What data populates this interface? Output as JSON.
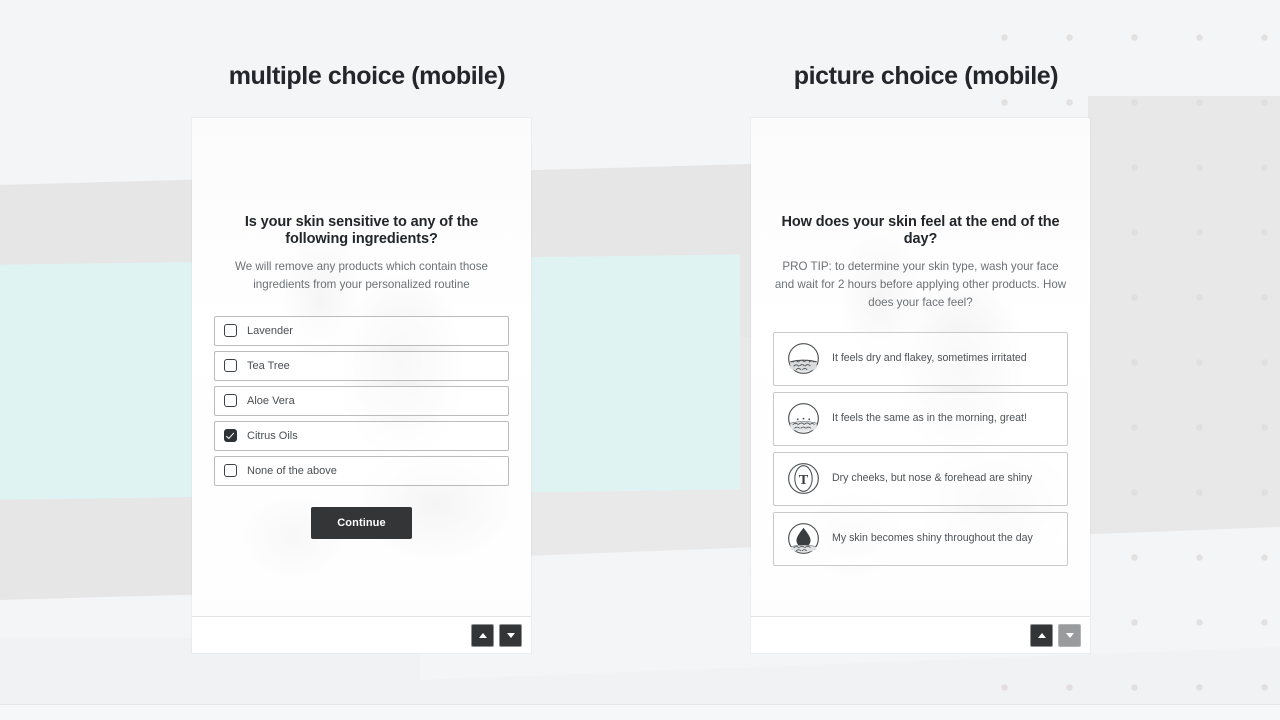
{
  "panels": [
    {
      "title": "multiple choice (mobile)",
      "type": "checkbox",
      "question": "Is your skin sensitive to any of the following ingredients?",
      "subtitle": "We will remove any products which contain those ingredients from your personalized routine",
      "options": [
        {
          "label": "Lavender",
          "checked": false
        },
        {
          "label": "Tea Tree",
          "checked": false
        },
        {
          "label": "Aloe Vera",
          "checked": false
        },
        {
          "label": "Citrus Oils",
          "checked": true
        },
        {
          "label": "None of the above",
          "checked": false
        }
      ],
      "continue_label": "Continue",
      "nav": {
        "up_icon": "triangle-up-icon",
        "down_icon": "triangle-down-icon",
        "up_disabled": false,
        "down_disabled": false
      }
    },
    {
      "title": "picture choice (mobile)",
      "type": "picture",
      "question": "How does your skin feel at the end of the day?",
      "subtitle": "PRO TIP: to determine your skin type, wash your face and wait for 2 hours before applying other products. How does your face feel?",
      "options": [
        {
          "label": "It feels dry and flakey, sometimes irritated",
          "icon": "dry-skin-icon"
        },
        {
          "label": "It feels the same as in the morning, great!",
          "icon": "normal-skin-icon"
        },
        {
          "label": "Dry cheeks, but nose & forehead are shiny",
          "icon": "t-zone-icon"
        },
        {
          "label": "My skin becomes shiny throughout the day",
          "icon": "oily-droplet-icon"
        }
      ],
      "nav": {
        "up_icon": "triangle-up-icon",
        "down_icon": "triangle-down-icon",
        "up_disabled": false,
        "down_disabled": true
      }
    }
  ],
  "colors": {
    "background": "#f4f5f7",
    "mint_band": "#dff4f2",
    "grey_band": "#e6e6e7",
    "dot": "#e0dcdc",
    "dark": "#333536",
    "text": "#22262a",
    "muted": "#6d7175",
    "border": "#b9bbbd"
  }
}
